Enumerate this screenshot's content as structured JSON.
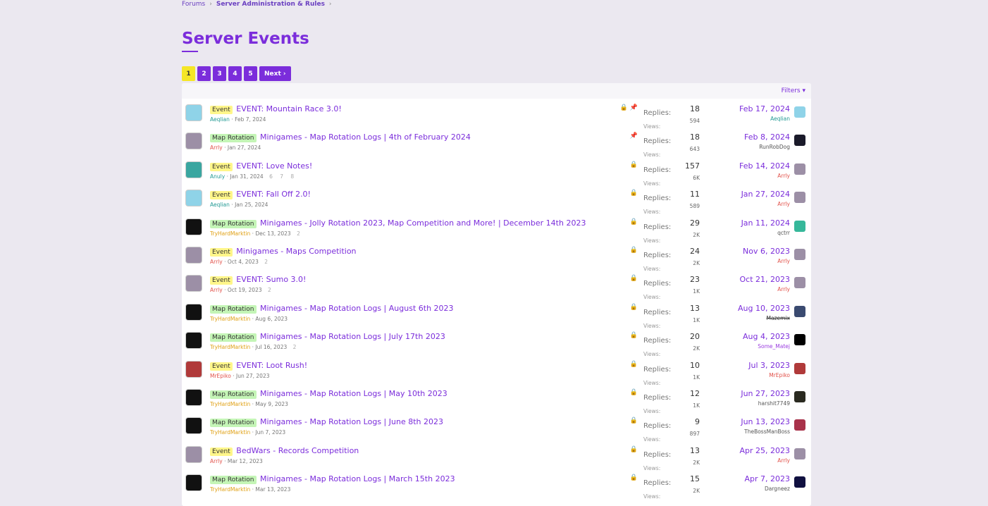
{
  "breadcrumb": {
    "items": [
      "Forums",
      "Server Administration & Rules"
    ]
  },
  "page_title": "Server Events",
  "pagination": {
    "pages": [
      "1",
      "2",
      "3",
      "4",
      "5"
    ],
    "current": "1",
    "next_label": "Next ›"
  },
  "filters_label": "Filters ▾",
  "labels": {
    "replies": "Replies:",
    "views": "Views:"
  },
  "threads": [
    {
      "prefix": "Event",
      "prefix_type": "event",
      "title": "EVENT: Mountain Race 3.0!",
      "author": "Aeqlian",
      "author_color": "teal",
      "date": "Feb 7, 2024",
      "pages": "",
      "icons": "🔒 📌",
      "replies": "18",
      "views": "594",
      "last_date": "Feb 17, 2024",
      "last_user": "Aeqlian",
      "last_user_color": "teal",
      "avatar": "#8fd3e8",
      "last_avatar": "#8fd3e8"
    },
    {
      "prefix": "Map Rotation",
      "prefix_type": "map",
      "title": "Minigames - Map Rotation Logs | 4th of February 2024",
      "author": "Arrly",
      "author_color": "red",
      "date": "Jan 27, 2024",
      "pages": "",
      "icons": "📌",
      "replies": "18",
      "views": "643",
      "last_date": "Feb 8, 2024",
      "last_user": "RunRobDog",
      "last_user_color": "gray",
      "avatar": "#9c8fa6",
      "last_avatar": "#1a1a2a"
    },
    {
      "prefix": "Event",
      "prefix_type": "event",
      "title": "EVENT: Love Notes!",
      "author": "Anuly",
      "author_color": "teal",
      "date": "Jan 31, 2024",
      "pages": "6 7 8",
      "icons": "🔒",
      "replies": "157",
      "views": "6K",
      "last_date": "Feb 14, 2024",
      "last_user": "Arrly",
      "last_user_color": "red",
      "avatar": "#3aa6a0",
      "last_avatar": "#9c8fa6"
    },
    {
      "prefix": "Event",
      "prefix_type": "event",
      "title": "EVENT: Fall Off 2.0!",
      "author": "Aeqlian",
      "author_color": "teal",
      "date": "Jan 25, 2024",
      "pages": "",
      "icons": "🔒",
      "replies": "11",
      "views": "589",
      "last_date": "Jan 27, 2024",
      "last_user": "Arrly",
      "last_user_color": "red",
      "avatar": "#8fd3e8",
      "last_avatar": "#9c8fa6"
    },
    {
      "prefix": "Map Rotation",
      "prefix_type": "map",
      "title": "Minigames - Jolly Rotation 2023, Map Competition and More! | December 14th 2023",
      "author": "TryHardMarktin",
      "author_color": "gold",
      "date": "Dec 13, 2023",
      "pages": "2",
      "icons": "🔒",
      "replies": "29",
      "views": "2K",
      "last_date": "Jan 11, 2024",
      "last_user": "qctrr",
      "last_user_color": "gray",
      "avatar": "#111111",
      "last_avatar": "#36b89a"
    },
    {
      "prefix": "Event",
      "prefix_type": "event",
      "title": "Minigames - Maps Competition",
      "author": "Arrly",
      "author_color": "red",
      "date": "Oct 4, 2023",
      "pages": "2",
      "icons": "🔒",
      "replies": "24",
      "views": "2K",
      "last_date": "Nov 6, 2023",
      "last_user": "Arrly",
      "last_user_color": "red",
      "avatar": "#9c8fa6",
      "last_avatar": "#9c8fa6"
    },
    {
      "prefix": "Event",
      "prefix_type": "event",
      "title": "EVENT: Sumo 3.0!",
      "author": "Arrly",
      "author_color": "red",
      "date": "Oct 19, 2023",
      "pages": "2",
      "icons": "🔒",
      "replies": "23",
      "views": "1K",
      "last_date": "Oct 21, 2023",
      "last_user": "Arrly",
      "last_user_color": "red",
      "avatar": "#9c8fa6",
      "last_avatar": "#9c8fa6"
    },
    {
      "prefix": "Map Rotation",
      "prefix_type": "map",
      "title": "Minigames - Map Rotation Logs | August 6th 2023",
      "author": "TryHardMarktin",
      "author_color": "gold",
      "date": "Aug 6, 2023",
      "pages": "",
      "icons": "🔒",
      "replies": "13",
      "views": "1K",
      "last_date": "Aug 10, 2023",
      "last_user": "Mazemix",
      "last_user_color": "strike",
      "avatar": "#111111",
      "last_avatar": "#3a4a70"
    },
    {
      "prefix": "Map Rotation",
      "prefix_type": "map",
      "title": "Minigames - Map Rotation Logs | July 17th 2023",
      "author": "TryHardMarktin",
      "author_color": "gold",
      "date": "Jul 16, 2023",
      "pages": "2",
      "icons": "🔒",
      "replies": "20",
      "views": "2K",
      "last_date": "Aug 4, 2023",
      "last_user": "Some_Matej",
      "last_user_color": "purple",
      "avatar": "#111111",
      "last_avatar": "#000000"
    },
    {
      "prefix": "Event",
      "prefix_type": "event",
      "title": "EVENT: Loot Rush!",
      "author": "MrEpiko",
      "author_color": "red",
      "date": "Jun 27, 2023",
      "pages": "",
      "icons": "🔒",
      "replies": "10",
      "views": "1K",
      "last_date": "Jul 3, 2023",
      "last_user": "MrEpiko",
      "last_user_color": "red",
      "avatar": "#b03a3a",
      "last_avatar": "#b03a3a"
    },
    {
      "prefix": "Map Rotation",
      "prefix_type": "map",
      "title": "Minigames - Map Rotation Logs | May 10th 2023",
      "author": "TryHardMarktin",
      "author_color": "gold",
      "date": "May 9, 2023",
      "pages": "",
      "icons": "🔒",
      "replies": "12",
      "views": "1K",
      "last_date": "Jun 27, 2023",
      "last_user": "harshit7749",
      "last_user_color": "gray",
      "avatar": "#111111",
      "last_avatar": "#2a2a20"
    },
    {
      "prefix": "Map Rotation",
      "prefix_type": "map",
      "title": "Minigames - Map Rotation Logs | June 8th 2023",
      "author": "TryHardMarktin",
      "author_color": "gold",
      "date": "Jun 7, 2023",
      "pages": "",
      "icons": "🔒",
      "replies": "9",
      "views": "897",
      "last_date": "Jun 13, 2023",
      "last_user": "TheBossManBoss",
      "last_user_color": "gray",
      "avatar": "#111111",
      "last_avatar": "#a8324a"
    },
    {
      "prefix": "Event",
      "prefix_type": "event",
      "title": "BedWars - Records Competition",
      "author": "Arrly",
      "author_color": "red",
      "date": "Mar 12, 2023",
      "pages": "",
      "icons": "🔒",
      "replies": "13",
      "views": "2K",
      "last_date": "Apr 25, 2023",
      "last_user": "Arrly",
      "last_user_color": "red",
      "avatar": "#9c8fa6",
      "last_avatar": "#9c8fa6"
    },
    {
      "prefix": "Map Rotation",
      "prefix_type": "map",
      "title": "Minigames - Map Rotation Logs | March 15th 2023",
      "author": "TryHardMarktin",
      "author_color": "gold",
      "date": "Mar 13, 2023",
      "pages": "",
      "icons": "🔒",
      "replies": "15",
      "views": "2K",
      "last_date": "Apr 7, 2023",
      "last_user": "Dargneez",
      "last_user_color": "gray",
      "avatar": "#111111",
      "last_avatar": "#101040"
    }
  ]
}
